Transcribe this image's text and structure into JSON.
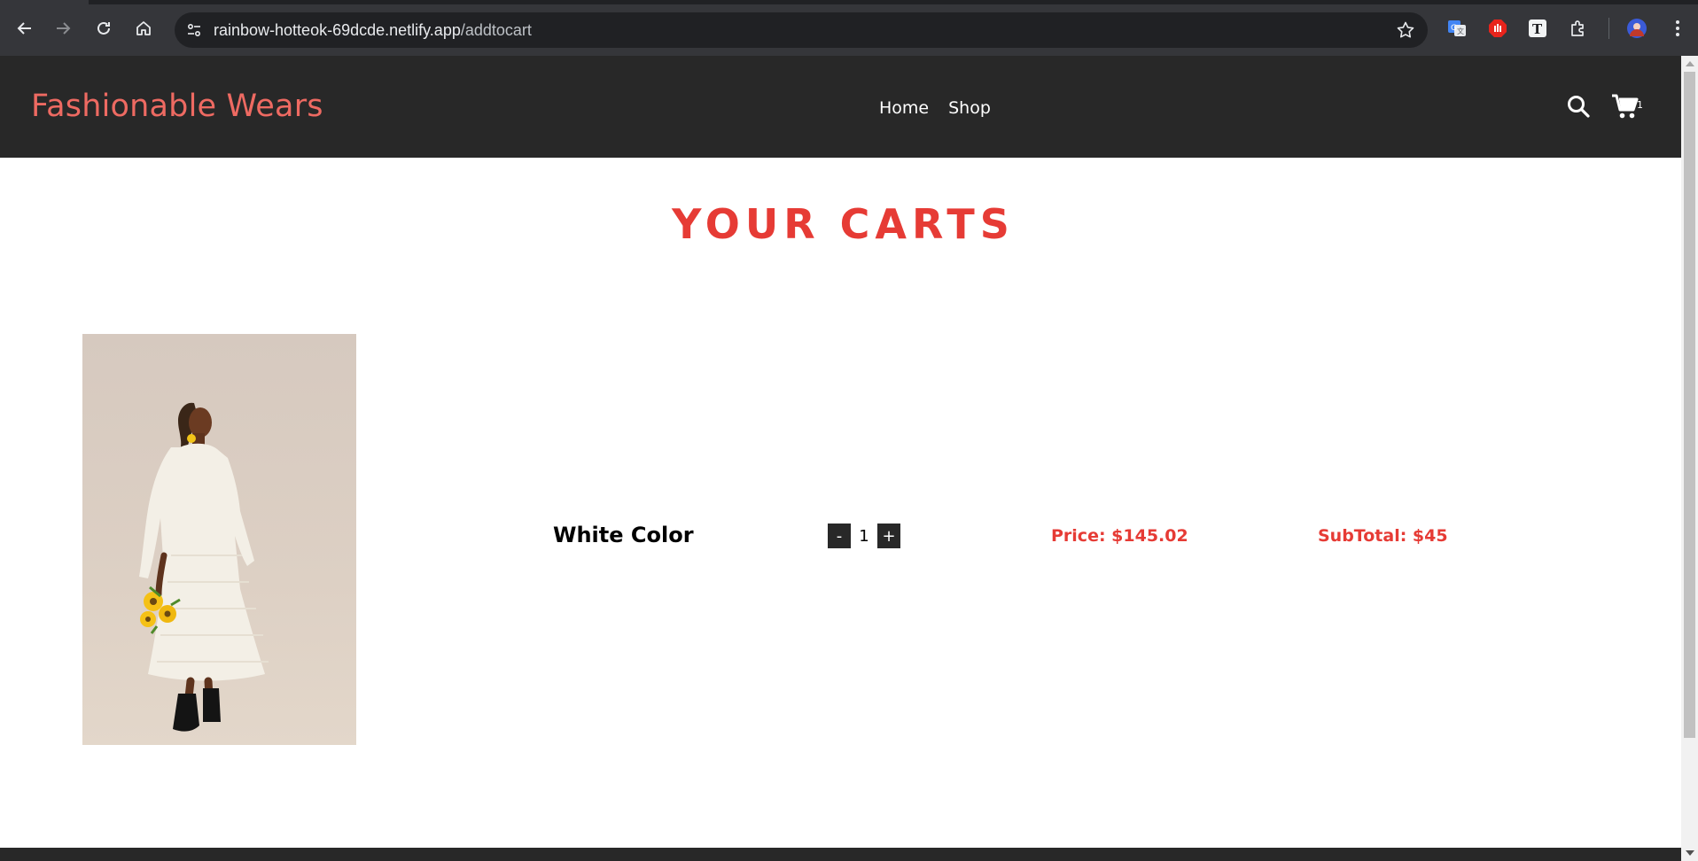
{
  "browser": {
    "url_host": "rainbow-hotteok-69dcde.netlify.app",
    "url_path": "/addtocart"
  },
  "site": {
    "brand": "Fashionable Wears",
    "nav": [
      {
        "label": "Home"
      },
      {
        "label": "Shop"
      }
    ],
    "cart_count": "1"
  },
  "cart": {
    "title": "YOUR CARTS",
    "items": [
      {
        "name": "White Color",
        "quantity": "1",
        "decrement_label": "-",
        "increment_label": "+",
        "price_text": "Price: $145.02",
        "subtotal_text": "SubTotal: $45"
      }
    ]
  },
  "colors": {
    "accent": "#e63b35",
    "brand": "#ee6a62",
    "header_bg": "#282828"
  }
}
